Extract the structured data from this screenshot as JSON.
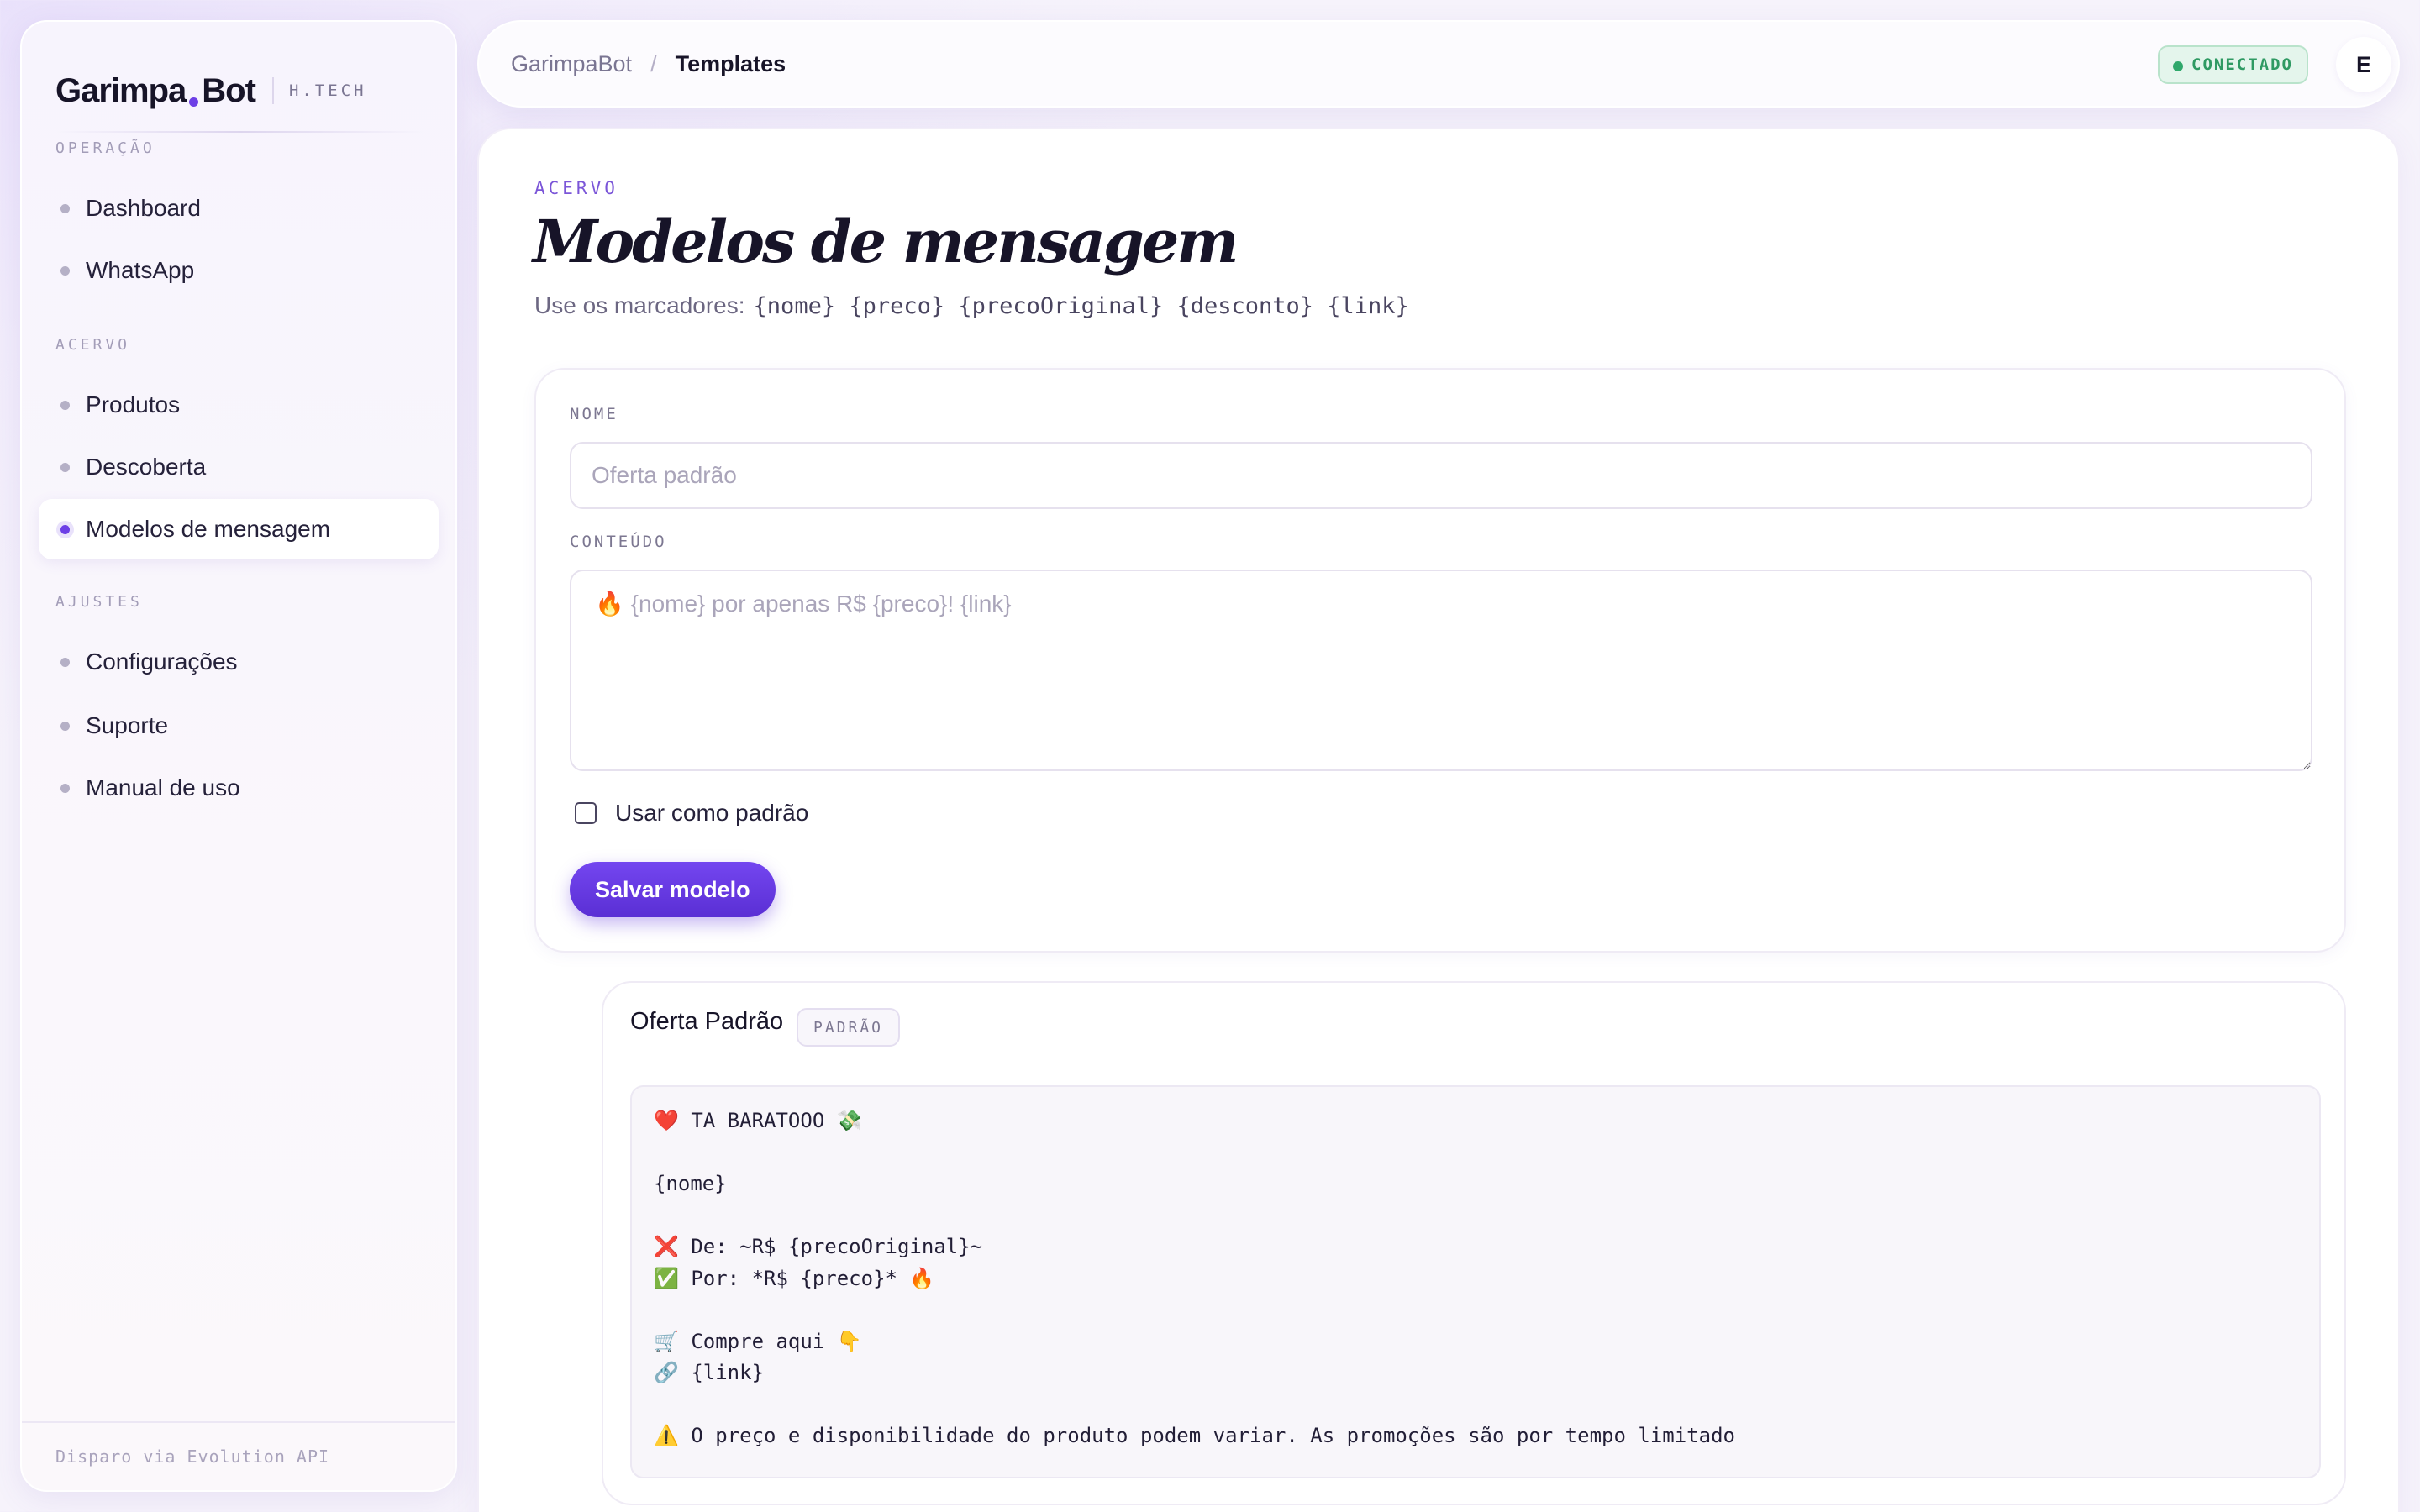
{
  "app": {
    "brand_name_part1": "Garimpa",
    "brand_name_part2": "Bot",
    "brand_tag": "H.TECH",
    "accent": "#6d3fe6"
  },
  "sidebar": {
    "sections": [
      {
        "label": "OPERAÇÃO",
        "items": [
          {
            "label": "Dashboard"
          },
          {
            "label": "WhatsApp"
          }
        ]
      },
      {
        "label": "ACERVO",
        "items": [
          {
            "label": "Produtos"
          },
          {
            "label": "Descoberta"
          },
          {
            "label": "Modelos de mensagem",
            "active": true
          }
        ]
      },
      {
        "label": "AJUSTES",
        "items": [
          {
            "label": "Configurações"
          },
          {
            "label": "Suporte"
          },
          {
            "label": "Manual de uso"
          }
        ]
      }
    ],
    "footer": "Disparo via Evolution API"
  },
  "topbar": {
    "breadcrumb_root": "GarimpaBot",
    "breadcrumb_separator": "/",
    "breadcrumb_current": "Templates",
    "status": "CONECTADO",
    "status_color": "#2fa86b",
    "avatar_initial": "E"
  },
  "page": {
    "eyebrow": "ACERVO",
    "title": "Modelos de mensagem",
    "subtitle_prefix": "Use os marcadores:",
    "subtitle_tokens": "{nome} {preco} {precoOriginal} {desconto} {link}"
  },
  "form": {
    "name_label": "NOME",
    "name_placeholder": "Oferta padrão",
    "content_label": "CONTEÚDO",
    "content_placeholder": "🔥 {nome} por apenas R$ {preco}! {link}",
    "default_checkbox_label": "Usar como padrão",
    "default_checked": false,
    "save_label": "Salvar modelo"
  },
  "templates": [
    {
      "name": "Oferta Padrão",
      "badge": "PADRÃO",
      "content": "❤️ TA BARATOOO 💸\n\n{nome}\n\n❌ De: ~R$ {precoOriginal}~\n✅ Por: *R$ {preco}* 🔥\n\n🛒 Compre aqui 👇\n🔗 {link}\n\n⚠️ O preço e disponibilidade do produto podem variar. As promoções são por tempo limitado"
    }
  ]
}
